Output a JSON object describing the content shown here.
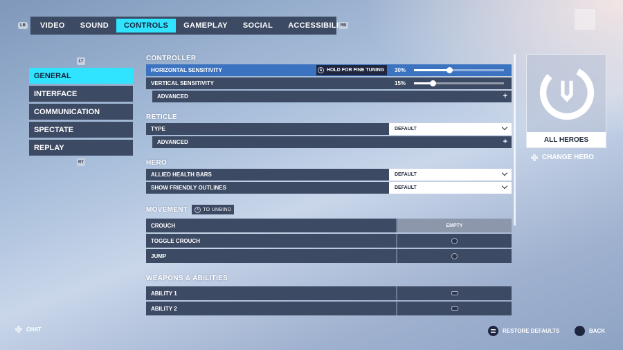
{
  "tabs": [
    {
      "label": "VIDEO"
    },
    {
      "label": "SOUND"
    },
    {
      "label": "CONTROLS",
      "active": true
    },
    {
      "label": "GAMEPLAY"
    },
    {
      "label": "SOCIAL"
    },
    {
      "label": "ACCESSIBILITY"
    }
  ],
  "bumpers": {
    "left": "LB",
    "right": "RB"
  },
  "triggers": {
    "top": "LT",
    "bottom": "RT"
  },
  "sidebar": {
    "items": [
      {
        "label": "GENERAL",
        "active": true
      },
      {
        "label": "INTERFACE"
      },
      {
        "label": "COMMUNICATION"
      },
      {
        "label": "SPECTATE"
      },
      {
        "label": "REPLAY"
      }
    ]
  },
  "controller": {
    "title": "CONTROLLER",
    "horizontal": {
      "label": "HORIZONTAL SENSITIVITY",
      "hint": "HOLD FOR FINE TUNING",
      "value": "30%",
      "fraction": 0.3
    },
    "vertical": {
      "label": "VERTICAL SENSITIVITY",
      "value": "15%",
      "fraction": 0.15
    },
    "advanced": "ADVANCED"
  },
  "reticle": {
    "title": "RETICLE",
    "type_label": "TYPE",
    "type_value": "DEFAULT",
    "advanced": "ADVANCED"
  },
  "hero": {
    "title": "HERO",
    "allied_label": "ALLIED HEALTH BARS",
    "allied_value": "DEFAULT",
    "outlines_label": "SHOW FRIENDLY OUTLINES",
    "outlines_value": "DEFAULT"
  },
  "movement": {
    "title": "MOVEMENT",
    "unbind_hint": "TO UNBIND",
    "crouch": "CROUCH",
    "crouch_binding": "EMPTY",
    "toggle_crouch": "TOGGLE CROUCH",
    "jump": "JUMP"
  },
  "weapons": {
    "title": "WEAPONS & ABILITIES",
    "ability1": "ABILITY 1",
    "ability2": "ABILITY 2"
  },
  "hero_panel": {
    "name": "ALL HEROES",
    "change": "CHANGE HERO"
  },
  "footer": {
    "chat": "CHAT",
    "restore": "RESTORE DEFAULTS",
    "back": "BACK"
  },
  "colors": {
    "accent": "#30e4ff",
    "highlight": "#3b73c1",
    "row": "#3d4a63"
  }
}
